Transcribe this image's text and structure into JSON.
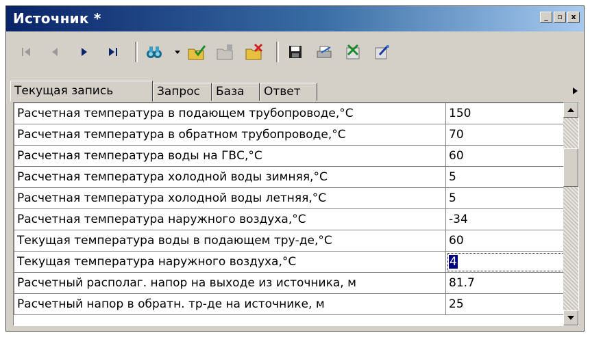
{
  "window": {
    "title": "Источник *",
    "controls": {
      "minimize": "_",
      "restore": "▫",
      "close": "x"
    }
  },
  "toolbar": {
    "buttons": [
      {
        "name": "first-record-icon"
      },
      {
        "name": "previous-record-icon"
      },
      {
        "name": "next-record-icon"
      },
      {
        "name": "last-record-icon"
      },
      {
        "name": "binoculars-icon"
      },
      {
        "name": "dropdown-arrow-icon"
      },
      {
        "name": "folder-check-icon"
      },
      {
        "name": "folder-add-icon"
      },
      {
        "name": "folder-delete-icon"
      },
      {
        "name": "save-icon"
      },
      {
        "name": "print-icon"
      },
      {
        "name": "excel-export-icon"
      },
      {
        "name": "edit-icon"
      }
    ]
  },
  "tabs": [
    {
      "label": "Текущая запись",
      "active": true
    },
    {
      "label": "Запрос",
      "active": false
    },
    {
      "label": "База",
      "active": false
    },
    {
      "label": "Ответ",
      "active": false
    }
  ],
  "rows": [
    {
      "label": "Расчетная температура в подающем трубопроводе,°С",
      "value": "150"
    },
    {
      "label": "Расчетная температура в обратном трубопроводе,°С",
      "value": "70"
    },
    {
      "label": "Расчетная температура воды на ГВС,°С",
      "value": "60"
    },
    {
      "label": "Расчетная температура холодной воды зимняя,°С",
      "value": "5"
    },
    {
      "label": "Расчетная температура холодной воды летняя,°С",
      "value": "5"
    },
    {
      "label": "Расчетная температура наружного воздуха,°С",
      "value": "-34"
    },
    {
      "label": "Текущая температура воды в подающем тру-де,°С",
      "value": "60"
    },
    {
      "label": "Текущая температура  наружного воздуха,°С",
      "value": "4"
    },
    {
      "label": "Расчетный располаг. напор на выходе из источника, м",
      "value": "81.7"
    },
    {
      "label": "Расчетный напор в обратн. тр-де на источнике, м",
      "value": "25"
    }
  ],
  "scrollbar": {
    "position_fraction": 0.2
  },
  "colors": {
    "title_gradient_start": "#0a246a",
    "title_gradient_end": "#a6caf0",
    "selection": "#000080",
    "face": "#d4d0c8"
  }
}
